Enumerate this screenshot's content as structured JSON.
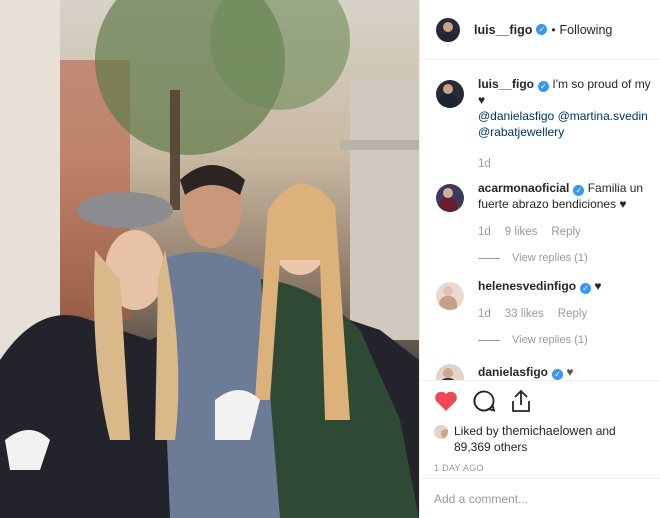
{
  "post": {
    "author": "luis__figo",
    "follow_status": "Following",
    "separator": "•"
  },
  "colors": {
    "accent": "#3897f0",
    "like": "#ed4956",
    "link": "#003569"
  },
  "caption": {
    "user": "luis__figo",
    "text": "I'm so proud of my ♥",
    "mentions": [
      "@danielasfigo",
      "@martina.svedin",
      "@rabatjewellery"
    ],
    "age": "1d"
  },
  "comments": [
    {
      "user": "acarmonaoficial",
      "text": "Familia un fuerte abrazo bendiciones ♥",
      "age": "1d",
      "likes": "9 likes",
      "reply": "Reply",
      "view_replies": "View replies (1)"
    },
    {
      "user": "helenesvedinfigo",
      "text": "♥",
      "age": "1d",
      "likes": "33 likes",
      "reply": "Reply",
      "view_replies": "View replies (1)"
    },
    {
      "user": "danielasfigo",
      "text": "♥"
    }
  ],
  "icons": [
    "heart-icon",
    "comment-icon",
    "share-icon",
    "verified-icon"
  ],
  "likes": {
    "prefix": "Liked by ",
    "user": "themichaelowen",
    "middle": " and",
    "count": "89,369 others"
  },
  "timestamp": "1 DAY AGO",
  "add_comment": {
    "placeholder": "Add a comment..."
  }
}
